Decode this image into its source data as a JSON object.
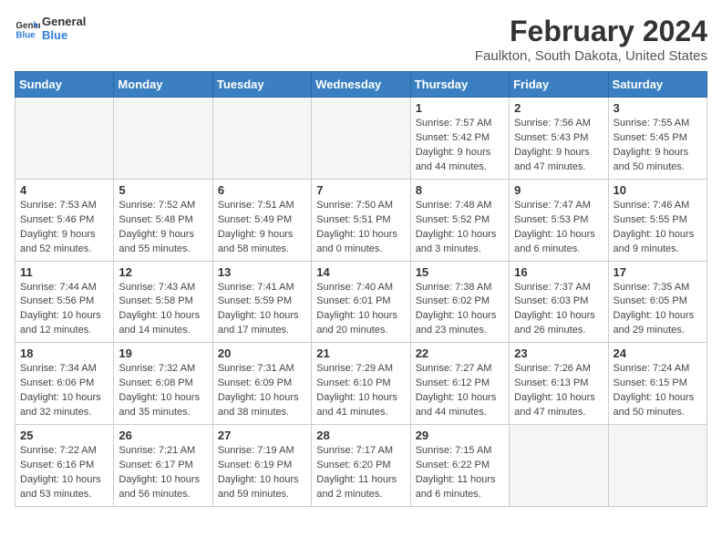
{
  "header": {
    "logo_line1": "General",
    "logo_line2": "Blue",
    "month_year": "February 2024",
    "location": "Faulkton, South Dakota, United States"
  },
  "days_of_week": [
    "Sunday",
    "Monday",
    "Tuesday",
    "Wednesday",
    "Thursday",
    "Friday",
    "Saturday"
  ],
  "weeks": [
    [
      {
        "day": "",
        "info": ""
      },
      {
        "day": "",
        "info": ""
      },
      {
        "day": "",
        "info": ""
      },
      {
        "day": "",
        "info": ""
      },
      {
        "day": "1",
        "info": "Sunrise: 7:57 AM\nSunset: 5:42 PM\nDaylight: 9 hours\nand 44 minutes."
      },
      {
        "day": "2",
        "info": "Sunrise: 7:56 AM\nSunset: 5:43 PM\nDaylight: 9 hours\nand 47 minutes."
      },
      {
        "day": "3",
        "info": "Sunrise: 7:55 AM\nSunset: 5:45 PM\nDaylight: 9 hours\nand 50 minutes."
      }
    ],
    [
      {
        "day": "4",
        "info": "Sunrise: 7:53 AM\nSunset: 5:46 PM\nDaylight: 9 hours\nand 52 minutes."
      },
      {
        "day": "5",
        "info": "Sunrise: 7:52 AM\nSunset: 5:48 PM\nDaylight: 9 hours\nand 55 minutes."
      },
      {
        "day": "6",
        "info": "Sunrise: 7:51 AM\nSunset: 5:49 PM\nDaylight: 9 hours\nand 58 minutes."
      },
      {
        "day": "7",
        "info": "Sunrise: 7:50 AM\nSunset: 5:51 PM\nDaylight: 10 hours\nand 0 minutes."
      },
      {
        "day": "8",
        "info": "Sunrise: 7:48 AM\nSunset: 5:52 PM\nDaylight: 10 hours\nand 3 minutes."
      },
      {
        "day": "9",
        "info": "Sunrise: 7:47 AM\nSunset: 5:53 PM\nDaylight: 10 hours\nand 6 minutes."
      },
      {
        "day": "10",
        "info": "Sunrise: 7:46 AM\nSunset: 5:55 PM\nDaylight: 10 hours\nand 9 minutes."
      }
    ],
    [
      {
        "day": "11",
        "info": "Sunrise: 7:44 AM\nSunset: 5:56 PM\nDaylight: 10 hours\nand 12 minutes."
      },
      {
        "day": "12",
        "info": "Sunrise: 7:43 AM\nSunset: 5:58 PM\nDaylight: 10 hours\nand 14 minutes."
      },
      {
        "day": "13",
        "info": "Sunrise: 7:41 AM\nSunset: 5:59 PM\nDaylight: 10 hours\nand 17 minutes."
      },
      {
        "day": "14",
        "info": "Sunrise: 7:40 AM\nSunset: 6:01 PM\nDaylight: 10 hours\nand 20 minutes."
      },
      {
        "day": "15",
        "info": "Sunrise: 7:38 AM\nSunset: 6:02 PM\nDaylight: 10 hours\nand 23 minutes."
      },
      {
        "day": "16",
        "info": "Sunrise: 7:37 AM\nSunset: 6:03 PM\nDaylight: 10 hours\nand 26 minutes."
      },
      {
        "day": "17",
        "info": "Sunrise: 7:35 AM\nSunset: 6:05 PM\nDaylight: 10 hours\nand 29 minutes."
      }
    ],
    [
      {
        "day": "18",
        "info": "Sunrise: 7:34 AM\nSunset: 6:06 PM\nDaylight: 10 hours\nand 32 minutes."
      },
      {
        "day": "19",
        "info": "Sunrise: 7:32 AM\nSunset: 6:08 PM\nDaylight: 10 hours\nand 35 minutes."
      },
      {
        "day": "20",
        "info": "Sunrise: 7:31 AM\nSunset: 6:09 PM\nDaylight: 10 hours\nand 38 minutes."
      },
      {
        "day": "21",
        "info": "Sunrise: 7:29 AM\nSunset: 6:10 PM\nDaylight: 10 hours\nand 41 minutes."
      },
      {
        "day": "22",
        "info": "Sunrise: 7:27 AM\nSunset: 6:12 PM\nDaylight: 10 hours\nand 44 minutes."
      },
      {
        "day": "23",
        "info": "Sunrise: 7:26 AM\nSunset: 6:13 PM\nDaylight: 10 hours\nand 47 minutes."
      },
      {
        "day": "24",
        "info": "Sunrise: 7:24 AM\nSunset: 6:15 PM\nDaylight: 10 hours\nand 50 minutes."
      }
    ],
    [
      {
        "day": "25",
        "info": "Sunrise: 7:22 AM\nSunset: 6:16 PM\nDaylight: 10 hours\nand 53 minutes."
      },
      {
        "day": "26",
        "info": "Sunrise: 7:21 AM\nSunset: 6:17 PM\nDaylight: 10 hours\nand 56 minutes."
      },
      {
        "day": "27",
        "info": "Sunrise: 7:19 AM\nSunset: 6:19 PM\nDaylight: 10 hours\nand 59 minutes."
      },
      {
        "day": "28",
        "info": "Sunrise: 7:17 AM\nSunset: 6:20 PM\nDaylight: 11 hours\nand 2 minutes."
      },
      {
        "day": "29",
        "info": "Sunrise: 7:15 AM\nSunset: 6:22 PM\nDaylight: 11 hours\nand 6 minutes."
      },
      {
        "day": "",
        "info": ""
      },
      {
        "day": "",
        "info": ""
      }
    ]
  ]
}
